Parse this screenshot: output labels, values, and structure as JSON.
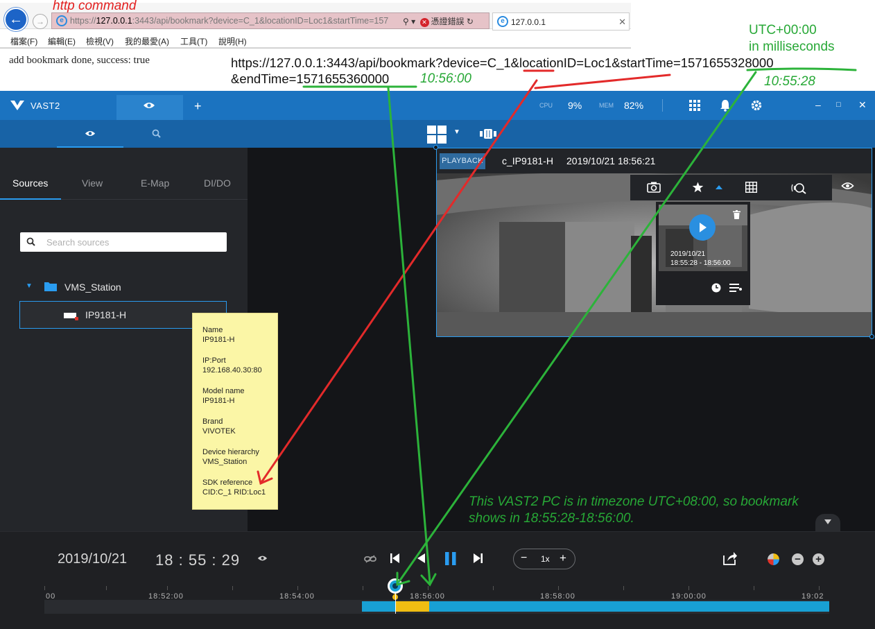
{
  "browser": {
    "annotation_title": "http command",
    "url": {
      "prefix": "https://",
      "host": "127.0.0.1",
      "rest": ":3443/api/bookmark?device=C_1&locationID=Loc1&startTime=157"
    },
    "cert_error": "憑證錯誤",
    "tab_title": "127.0.0.1",
    "menu": [
      "檔案(F)",
      "編輯(E)",
      "檢視(V)",
      "我的最愛(A)",
      "工具(T)",
      "說明(H)"
    ],
    "page_text": "add bookmark done, success: true"
  },
  "annotations": {
    "url_line1": "https://127.0.0.1:3443/api/bookmark?device=C_1&locationID=Loc1&startTime=1571655328000",
    "url_line2": "&endTime=1571655360000",
    "utc_title": "UTC+00:00",
    "utc_subtitle": "in milliseconds",
    "end_local": "10:56:00",
    "start_local": "10:55:28",
    "timezone_note_line1": "This VAST2 PC is in timezone UTC+08:00, so bookmark",
    "timezone_note_line2": "shows in 18:55:28-18:56:00.",
    "arrow_colors": {
      "red": "#e32a2a",
      "green": "#2cb33a"
    }
  },
  "app": {
    "brand": "VAST2",
    "cpu_label": "CPU",
    "cpu_value": "9%",
    "mem_label": "MEM",
    "mem_value": "82%",
    "accent": "#1b73c0",
    "highlight": "#2a9cf0"
  },
  "sidebar": {
    "tabs": [
      "Sources",
      "View",
      "E-Map",
      "DI/DO"
    ],
    "active_tab": "Sources",
    "search_placeholder": "Search sources",
    "station": "VMS_Station",
    "device": "IP9181-H"
  },
  "tooltip": [
    {
      "label": "Name",
      "value": "IP9181-H"
    },
    {
      "label": "IP:Port",
      "value": "192.168.40.30:80"
    },
    {
      "label": "Model name",
      "value": "IP9181-H"
    },
    {
      "label": "Brand",
      "value": "VIVOTEK"
    },
    {
      "label": "Device hierarchy",
      "value": "VMS_Station"
    },
    {
      "label": "SDK reference",
      "value": "CID:C_1 RID:Loc1"
    }
  ],
  "tile": {
    "mode_badge": "PLAYBACK",
    "camera": "c_IP9181-H",
    "timestamp": "2019/10/21 18:56:21"
  },
  "bookmark": {
    "date": "2019/10/21",
    "range": "18:55:28 - 18:56:00"
  },
  "playback": {
    "date": "2019/10/21",
    "hh": "18",
    "mm": "55",
    "ss": "29",
    "speed": "1x",
    "timeline_labels": [
      "00",
      "18:52:00",
      "18:54:00",
      "18:56:00",
      "18:58:00",
      "19:00:00",
      "19:02"
    ]
  }
}
